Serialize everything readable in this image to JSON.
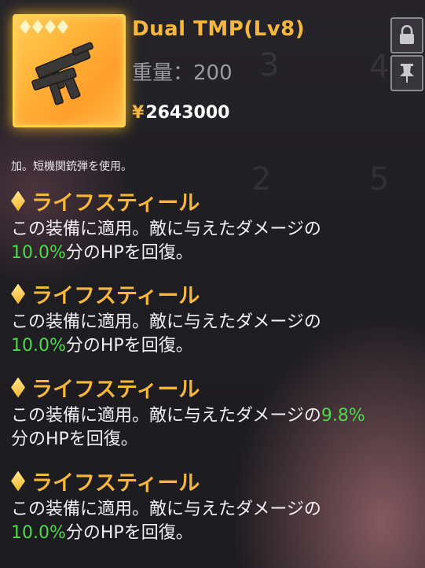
{
  "item": {
    "rarity_stars": 4,
    "name": "Dual TMP(Lv8)",
    "weight_label": "重量：200",
    "currency_symbol": "¥",
    "price": "2643000",
    "description": "加。短機関銃弾を使用。"
  },
  "side_buttons": [
    {
      "icon": "lock-icon"
    },
    {
      "icon": "pin-icon"
    }
  ],
  "skills": [
    {
      "title": "ライフスティール",
      "text_before": "この装備に適用。敵に与えたダメージの",
      "value": "10.0%",
      "text_after": "分のHPを回復。"
    },
    {
      "title": "ライフスティール",
      "text_before": "この装備に適用。敵に与えたダメージの",
      "value": "10.0%",
      "text_after": "分のHPを回復。"
    },
    {
      "title": "ライフスティール",
      "text_before": "この装備に適用。敵に与えたダメージの",
      "value": "9.8%",
      "text_after": "分のHPを回復。"
    },
    {
      "title": "ライフスティール",
      "text_before": "この装備に適用。敵に与えたダメージの",
      "value": "10.0%",
      "text_after": "分のHPを回復。"
    }
  ],
  "colors": {
    "accent_gold": "#f6b73c",
    "value_green": "#4cd94a",
    "frame_glow": "#ffd24a"
  }
}
